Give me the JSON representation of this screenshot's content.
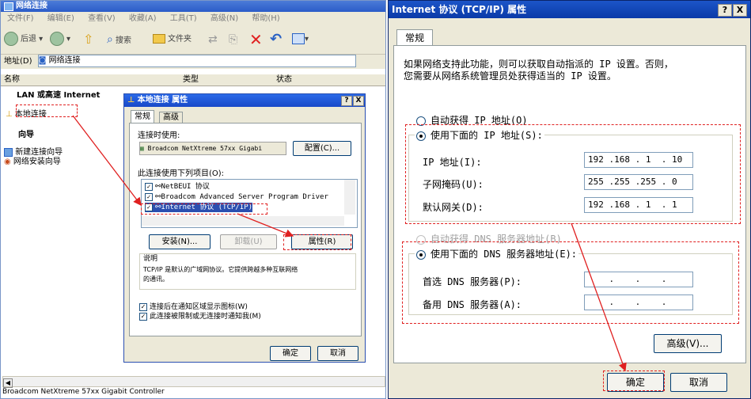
{
  "explorer": {
    "title": "网络连接",
    "menu": [
      "文件(F)",
      "编辑(E)",
      "查看(V)",
      "收藏(A)",
      "工具(T)",
      "高级(N)",
      "帮助(H)"
    ],
    "toolbar": {
      "back": "后退",
      "search": "搜索",
      "folders": "文件夹"
    },
    "address_label": "地址(D)",
    "address_value": "网络连接",
    "columns": [
      "名称",
      "类型",
      "状态"
    ],
    "section_lan": "LAN 或高速 Internet",
    "connection_item": "本地连接",
    "section_wizard": "向导",
    "wizards": [
      "新建连接向导",
      "网络安装向导"
    ],
    "status_bar": "Broadcom NetXtreme 57xx Gigabit Controller"
  },
  "props": {
    "title": "本地连接 属性",
    "help_btn": "?",
    "close_btn": "X",
    "tabs": [
      "常规",
      "高级"
    ],
    "connect_using_label": "连接时使用:",
    "adapter": "Broadcom NetXtreme 57xx Gigabi",
    "configure_btn": "配置(C)...",
    "items_label": "此连接使用下列项目(O):",
    "items": [
      "NetBEUI 协议",
      "Broadcom Advanced Server Program Driver",
      "Internet 协议 (TCP/IP)"
    ],
    "install_btn": "安装(N)...",
    "uninstall_btn": "卸载(U)",
    "properties_btn": "属性(R)",
    "desc_label": "说明",
    "desc_text_1": "TCP/IP 是默认的广域网协议。它提供跨越多种互联网络",
    "desc_text_2": "的通讯。",
    "check_show_icon": "连接后在通知区域显示图标(W)",
    "check_notify": "此连接被限制或无连接时通知我(M)",
    "ok_btn": "确定",
    "cancel_btn": "取消"
  },
  "tcp": {
    "title": "Internet 协议 (TCP/IP) 属性",
    "help_btn": "?",
    "close_btn": "X",
    "tab": "常规",
    "intro_1": "如果网络支持此功能，则可以获取自动指派的 IP 设置。否则，",
    "intro_2": "您需要从网络系统管理员处获得适当的 IP 设置。",
    "auto_ip": "自动获得 IP 地址(O)",
    "manual_ip": "使用下面的 IP 地址(S):",
    "ip_label": "IP 地址(I):",
    "ip_value": "192 .168 . 1  . 10",
    "mask_label": "子网掩码(U):",
    "mask_value": "255 .255 .255 . 0",
    "gateway_label": "默认网关(D):",
    "gateway_value": "192 .168 . 1  . 1",
    "auto_dns": "自动获得 DNS 服务器地址(B)",
    "manual_dns": "使用下面的 DNS 服务器地址(E):",
    "dns1_label": "首选 DNS 服务器(P):",
    "dns1_value": "    .    .    .",
    "dns2_label": "备用 DNS 服务器(A):",
    "dns2_value": "    .    .    .",
    "advanced_btn": "高级(V)...",
    "ok_btn": "确定",
    "cancel_btn": "取消"
  },
  "colors": {
    "highlight": "#e02020",
    "title_blue": "#1848c8",
    "dialog_bg": "#ece9d8"
  }
}
